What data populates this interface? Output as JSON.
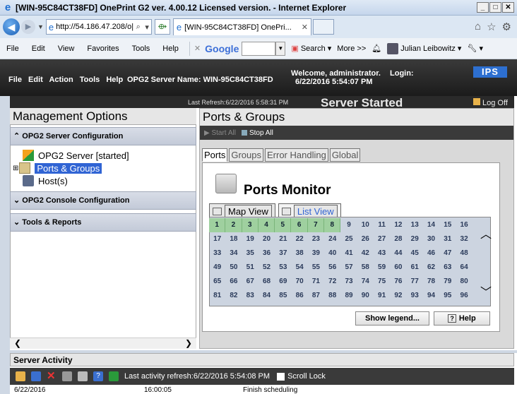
{
  "browser": {
    "title": "[WIN-95C84CT38FD] OnePrint G2 ver. 4.00.12 Licensed version. - Internet Explorer",
    "url": "http://54.186.47.208/o|",
    "tab_label": "[WIN-95C84CT38FD] OnePri...",
    "menu": [
      "File",
      "Edit",
      "View",
      "Favorites",
      "Tools",
      "Help"
    ],
    "google_label": "Google",
    "search_label": "Search",
    "more_label": "More >>",
    "user_label": "Julian Leibowitz"
  },
  "app_header": {
    "menu": [
      "File",
      "Edit",
      "Action",
      "Tools",
      "Help"
    ],
    "server_name": "OPG2 Server Name: WIN-95C84CT38FD",
    "welcome": "Welcome, administrator.",
    "datetime": "6/22/2016 5:54:07 PM",
    "login": "Login:",
    "brand": "IPS",
    "last_refresh": "Last Refresh:6/22/2016 5:58:31 PM",
    "status": "Server Started",
    "logoff": "Log Off"
  },
  "left_panel": {
    "title": "Management Options",
    "section1": "OPG2 Server Configuration",
    "items": [
      "OPG2 Server [started]",
      "Ports & Groups",
      "Host(s)"
    ],
    "section2": "OPG2 Console Configuration",
    "section3": "Tools & Reports"
  },
  "right_panel": {
    "title": "Ports & Groups",
    "start_all": "Start All",
    "stop_all": "Stop All",
    "tabs": [
      "Ports",
      "Groups",
      "Error Handling",
      "Global"
    ],
    "monitor_title": "Ports Monitor",
    "view_tabs": [
      "Map View",
      "List View"
    ],
    "ports": [
      [
        "1",
        "2",
        "3",
        "4",
        "5",
        "6",
        "7",
        "8",
        "9",
        "10",
        "11",
        "12",
        "13",
        "14",
        "15",
        "16"
      ],
      [
        "17",
        "18",
        "19",
        "20",
        "21",
        "22",
        "23",
        "24",
        "25",
        "26",
        "27",
        "28",
        "29",
        "30",
        "31",
        "32"
      ],
      [
        "33",
        "34",
        "35",
        "36",
        "37",
        "38",
        "39",
        "40",
        "41",
        "42",
        "43",
        "44",
        "45",
        "46",
        "47",
        "48"
      ],
      [
        "49",
        "50",
        "51",
        "52",
        "53",
        "54",
        "55",
        "56",
        "57",
        "58",
        "59",
        "60",
        "61",
        "62",
        "63",
        "64"
      ],
      [
        "65",
        "66",
        "67",
        "68",
        "69",
        "70",
        "71",
        "72",
        "73",
        "74",
        "75",
        "76",
        "77",
        "78",
        "79",
        "80"
      ],
      [
        "81",
        "82",
        "83",
        "84",
        "85",
        "86",
        "87",
        "88",
        "89",
        "90",
        "91",
        "92",
        "93",
        "94",
        "95",
        "96"
      ]
    ],
    "active_ports": 8,
    "show_legend": "Show legend...",
    "help": "Help"
  },
  "activity": {
    "title": "Server Activity",
    "last_refresh": "Last activity refresh:6/22/2016 5:54:08 PM",
    "scroll_lock": "Scroll Lock",
    "row": {
      "date": "6/22/2016",
      "time": "16:00:05",
      "message": "Finish scheduling"
    }
  }
}
